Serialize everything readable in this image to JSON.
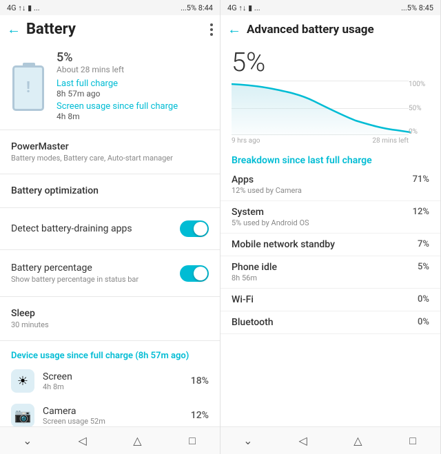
{
  "left": {
    "statusBar": {
      "left": "4G ↑↓  ▮  ...",
      "right": "...5%  8:44"
    },
    "title": "Battery",
    "backArrow": "←",
    "moreIcon": "⋮",
    "battery": {
      "percentage": "5%",
      "timeLeft": "About 28 mins left",
      "lastChargeLabel": "Last full charge",
      "lastChargeValue": "8h 57m ago",
      "screenChargeLabel": "Screen usage since full charge",
      "screenChargeValue": "4h 8m"
    },
    "powerMaster": {
      "title": "PowerMaster",
      "sub": "Battery modes, Battery care, Auto-start manager"
    },
    "batteryOptimization": {
      "title": "Battery optimization"
    },
    "detectDraining": {
      "title": "Detect battery-draining apps",
      "toggle": true
    },
    "batteryPercentage": {
      "title": "Battery percentage",
      "sub": "Show battery percentage in status bar",
      "toggle": true
    },
    "sleep": {
      "title": "Sleep",
      "sub": "30 minutes"
    },
    "deviceUsageHeader": "Device usage since full charge (8h 57m ago)",
    "usageItems": [
      {
        "icon": "☀",
        "name": "Screen",
        "detail": "4h 8m",
        "pct": "18%",
        "iconBg": "#e0f4f8"
      },
      {
        "icon": "📷",
        "name": "Camera",
        "detail": "Screen usage 52m",
        "pct": "12%",
        "iconBg": "#ddeef5"
      }
    ],
    "nav": [
      "⌄",
      "◁",
      "△",
      "□"
    ]
  },
  "right": {
    "statusBar": {
      "left": "4G ↑↓  ▮  ...",
      "right": "...5%  8:45"
    },
    "title": "Advanced battery usage",
    "backArrow": "←",
    "percentage": "5%",
    "chart": {
      "yLabels": [
        "100%",
        "50%",
        "0%"
      ],
      "xLabels": [
        "9 hrs ago",
        "28 mins left"
      ],
      "gridlines": [
        0,
        40,
        80
      ]
    },
    "breakdownHeader": "Breakdown since last full charge",
    "breakdown": [
      {
        "name": "Apps",
        "sub": "12% used by Camera",
        "pct": "71%"
      },
      {
        "name": "System",
        "sub": "5% used by Android OS",
        "pct": "12%"
      },
      {
        "name": "Mobile network standby",
        "sub": "",
        "pct": "7%"
      },
      {
        "name": "Phone idle",
        "sub": "8h 56m",
        "pct": "5%"
      },
      {
        "name": "Wi-Fi",
        "sub": "",
        "pct": "0%"
      },
      {
        "name": "Bluetooth",
        "sub": "",
        "pct": "0%"
      }
    ],
    "nav": [
      "⌄",
      "◁",
      "△",
      "□"
    ]
  }
}
